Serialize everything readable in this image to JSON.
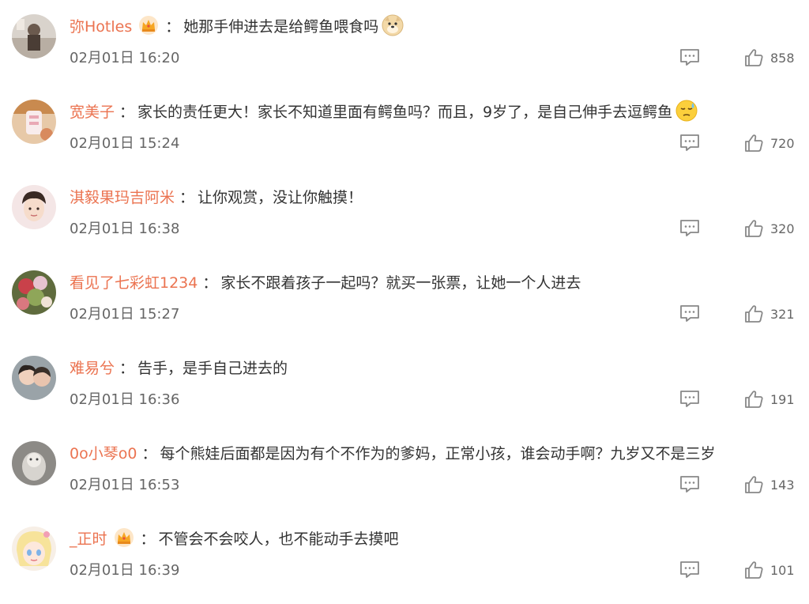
{
  "colors": {
    "username": "#eb7350",
    "text": "#333333",
    "meta": "#666666"
  },
  "comments": [
    {
      "username": "弥Hotles",
      "has_vip_crown": true,
      "separator": "：",
      "text": "她那手伸进去是给鳄鱼喂食吗",
      "emoji": "doge-emoji",
      "time": "02月01日 16:20",
      "likes": "858"
    },
    {
      "username": "宽美子",
      "has_vip_crown": false,
      "separator": "：",
      "text": "家长的责任更大！家长不知道里面有鳄鱼吗？而且，9岁了，是自己伸手去逗鳄鱼",
      "emoji": "sweat-emoji",
      "time": "02月01日 15:24",
      "likes": "720"
    },
    {
      "username": "淇毅果玛吉阿米",
      "has_vip_crown": false,
      "separator": "：",
      "text": "让你观赏，没让你触摸！",
      "time": "02月01日 16:38",
      "likes": "320"
    },
    {
      "username": "看见了七彩虹1234",
      "has_vip_crown": false,
      "separator": "：",
      "text": "家长不跟着孩子一起吗？就买一张票，让她一个人进去",
      "time": "02月01日 15:27",
      "likes": "321"
    },
    {
      "username": "难易兮",
      "has_vip_crown": false,
      "separator": "：",
      "text": "告手，是手自己进去的",
      "time": "02月01日 16:36",
      "likes": "191"
    },
    {
      "username": "0o小琴o0",
      "has_vip_crown": false,
      "separator": "：",
      "text": "每个熊娃后面都是因为有个不作为的爹妈，正常小孩，谁会动手啊？九岁又不是三岁",
      "time": "02月01日 16:53",
      "likes": "143"
    },
    {
      "username": "_正时",
      "has_vip_crown": true,
      "separator": "：",
      "text": "不管会不会咬人，也不能动手去摸吧",
      "time": "02月01日 16:39",
      "likes": "101"
    }
  ]
}
